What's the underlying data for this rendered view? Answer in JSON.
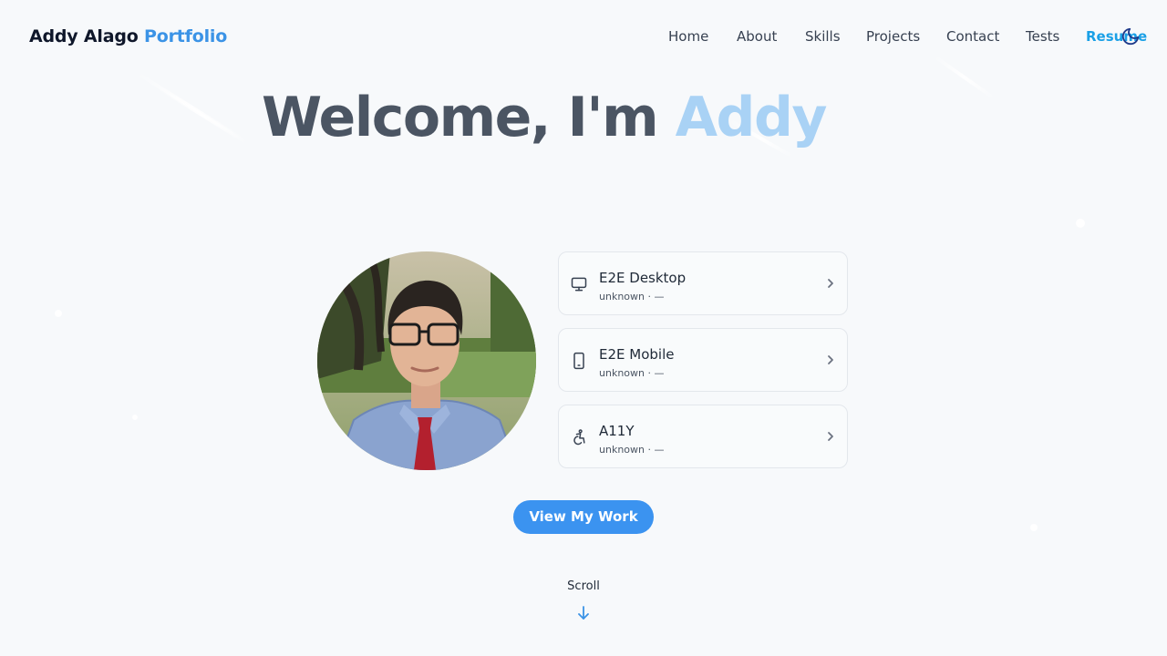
{
  "header": {
    "brand_name": "Addy Alago",
    "brand_suffix": "Portfolio",
    "nav": [
      {
        "label": "Home"
      },
      {
        "label": "About"
      },
      {
        "label": "Skills"
      },
      {
        "label": "Projects"
      },
      {
        "label": "Contact"
      },
      {
        "label": "Tests"
      },
      {
        "label": "Resume"
      }
    ],
    "theme_toggle_icon": "moon-icon"
  },
  "hero": {
    "title_prefix": "Welcome, I'm",
    "title_name": "Addy"
  },
  "profile": {
    "photo_icon": "profile-photo"
  },
  "test_cards": [
    {
      "title": "E2E Desktop",
      "subtitle": "unknown · —",
      "icon": "monitor-icon"
    },
    {
      "title": "E2E Mobile",
      "subtitle": "unknown · —",
      "icon": "mobile-icon"
    },
    {
      "title": "A11Y",
      "subtitle": "unknown · —",
      "icon": "accessibility-icon"
    }
  ],
  "cta": {
    "label": "View My Work"
  },
  "scroll": {
    "label": "Scroll",
    "icon": "arrow-down-icon"
  },
  "colors": {
    "accent": "#3b93e6",
    "button": "#3b93f0",
    "resume_link": "#1aa0e6",
    "hero_accent": "#a9d2f5",
    "background": "#f7f9fb"
  }
}
